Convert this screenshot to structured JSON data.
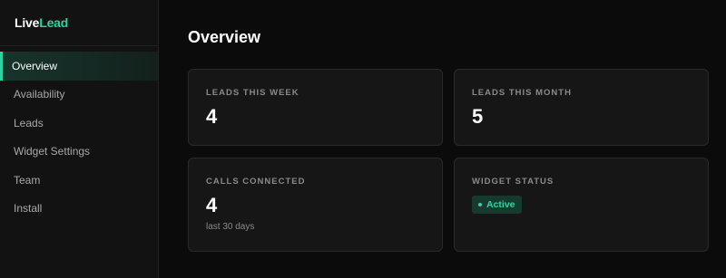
{
  "brand": {
    "part1": "Live",
    "part2": "Lead",
    "accent_color": "#2ed3a0"
  },
  "sidebar": {
    "items": [
      {
        "label": "Overview",
        "active": true
      },
      {
        "label": "Availability",
        "active": false
      },
      {
        "label": "Leads",
        "active": false
      },
      {
        "label": "Widget Settings",
        "active": false
      },
      {
        "label": "Team",
        "active": false
      },
      {
        "label": "Install",
        "active": false
      }
    ]
  },
  "main": {
    "title": "Overview",
    "cards": {
      "leads_week": {
        "label": "LEADS THIS WEEK",
        "value": "4"
      },
      "leads_month": {
        "label": "LEADS THIS MONTH",
        "value": "5"
      },
      "calls": {
        "label": "CALLS CONNECTED",
        "value": "4",
        "sub": "last 30 days"
      },
      "widget": {
        "label": "WIDGET STATUS",
        "status": "Active",
        "status_color": "#2ed3a0"
      }
    }
  }
}
